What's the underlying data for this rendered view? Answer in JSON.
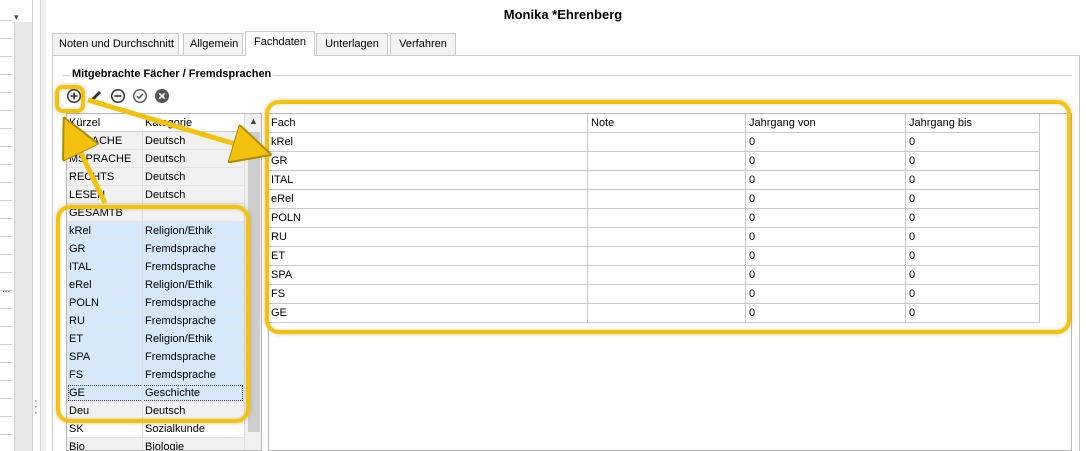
{
  "window": {
    "title": "Monika *Ehrenberg"
  },
  "tabs": [
    {
      "label": "Noten und Durchschnitt"
    },
    {
      "label": "Allgemein"
    },
    {
      "label": "Fachdaten",
      "active": true
    },
    {
      "label": "Unterlagen"
    },
    {
      "label": "Verfahren"
    }
  ],
  "group": {
    "title": "Mitgebrachte Fächer / Fremdsprachen"
  },
  "toolbar": {
    "buttons": [
      {
        "icon": "add-circle-icon"
      },
      {
        "icon": "pencil-icon"
      },
      {
        "icon": "remove-circle-icon"
      },
      {
        "icon": "check-circle-icon"
      },
      {
        "icon": "cancel-circle-icon"
      }
    ]
  },
  "left_list": {
    "columns": [
      "Kürzel",
      "Kategorie"
    ],
    "rows": [
      {
        "kuerzel": "SPRACHE",
        "kategorie": "Deutsch",
        "state": "gray"
      },
      {
        "kuerzel": "MSPRACHE",
        "kategorie": "Deutsch",
        "state": "gray"
      },
      {
        "kuerzel": "RECHTS",
        "kategorie": "Deutsch",
        "state": "gray"
      },
      {
        "kuerzel": "LESEN",
        "kategorie": "Deutsch",
        "state": "gray"
      },
      {
        "kuerzel": "GESAMTB",
        "kategorie": "",
        "state": "gray"
      },
      {
        "kuerzel": "kRel",
        "kategorie": "Religion/Ethik",
        "state": "selected"
      },
      {
        "kuerzel": "GR",
        "kategorie": "Fremdsprache",
        "state": "selected"
      },
      {
        "kuerzel": "ITAL",
        "kategorie": "Fremdsprache",
        "state": "selected"
      },
      {
        "kuerzel": "eRel",
        "kategorie": "Religion/Ethik",
        "state": "selected"
      },
      {
        "kuerzel": "POLN",
        "kategorie": "Fremdsprache",
        "state": "selected"
      },
      {
        "kuerzel": "RU",
        "kategorie": "Fremdsprache",
        "state": "selected"
      },
      {
        "kuerzel": "ET",
        "kategorie": "Religion/Ethik",
        "state": "selected"
      },
      {
        "kuerzel": "SPA",
        "kategorie": "Fremdsprache",
        "state": "selected"
      },
      {
        "kuerzel": "FS",
        "kategorie": "Fremdsprache",
        "state": "selected"
      },
      {
        "kuerzel": "GE",
        "kategorie": "Geschichte",
        "state": "focused"
      },
      {
        "kuerzel": "Deu",
        "kategorie": "Deutsch",
        "state": "gray"
      },
      {
        "kuerzel": "SK",
        "kategorie": "Sozialkunde",
        "state": "normal"
      },
      {
        "kuerzel": "Bio",
        "kategorie": "Biologie",
        "state": "gray"
      }
    ]
  },
  "right_grid": {
    "columns": [
      "Fach",
      "Note",
      "Jahrgang von",
      "Jahrgang bis"
    ],
    "rows": [
      {
        "fach": "kRel",
        "note": "",
        "von": "0",
        "bis": "0"
      },
      {
        "fach": "GR",
        "note": "",
        "von": "0",
        "bis": "0"
      },
      {
        "fach": "ITAL",
        "note": "",
        "von": "0",
        "bis": "0"
      },
      {
        "fach": "eRel",
        "note": "",
        "von": "0",
        "bis": "0"
      },
      {
        "fach": "POLN",
        "note": "",
        "von": "0",
        "bis": "0"
      },
      {
        "fach": "RU",
        "note": "",
        "von": "0",
        "bis": "0"
      },
      {
        "fach": "ET",
        "note": "",
        "von": "0",
        "bis": "0"
      },
      {
        "fach": "SPA",
        "note": "",
        "von": "0",
        "bis": "0"
      },
      {
        "fach": "FS",
        "note": "",
        "von": "0",
        "bis": "0"
      },
      {
        "fach": "GE",
        "note": "",
        "von": "0",
        "bis": "0"
      }
    ]
  },
  "left_strip": {
    "ellipsis": "..."
  },
  "colors": {
    "highlight": "#f2c20e",
    "selection": "#d6e9fa",
    "row_gray": "#f1f1f1",
    "grid_line": "#c8c8c8"
  }
}
